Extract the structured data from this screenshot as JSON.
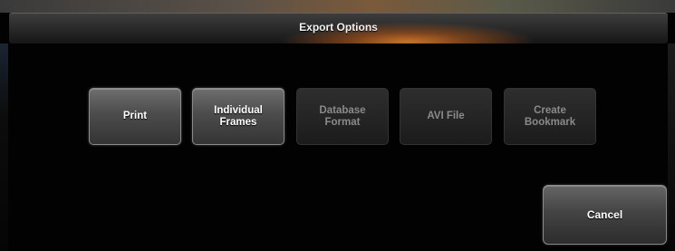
{
  "dialog": {
    "title": "Export Options"
  },
  "options": [
    {
      "label": "Print",
      "enabled": true
    },
    {
      "label": "Individual\nFrames",
      "enabled": true
    },
    {
      "label": "Database\nFormat",
      "enabled": false
    },
    {
      "label": "AVI File",
      "enabled": false
    },
    {
      "label": "Create\nBookmark",
      "enabled": false
    }
  ],
  "cancel_label": "Cancel",
  "colors": {
    "accent": "#c8782a",
    "background": "#020202",
    "button_enabled": "#5a5a5a",
    "button_disabled": "#262626"
  }
}
